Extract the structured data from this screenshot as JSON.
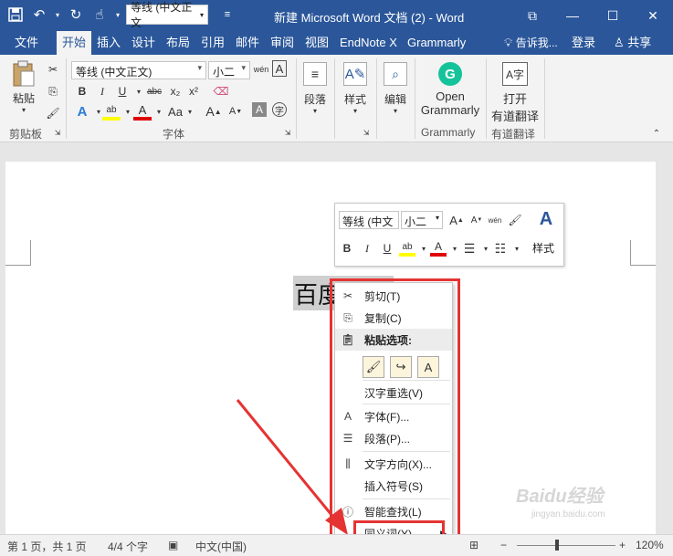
{
  "titlebar": {
    "title": "新建 Microsoft Word 文档 (2) - Word",
    "qat_font": "等线 (中文正文",
    "icons": [
      "save-icon",
      "undo-icon",
      "redo-icon",
      "touch-icon",
      "customize-icon"
    ]
  },
  "tabs": [
    {
      "label": "文件"
    },
    {
      "label": "开始",
      "active": true
    },
    {
      "label": "插入"
    },
    {
      "label": "设计"
    },
    {
      "label": "布局"
    },
    {
      "label": "引用"
    },
    {
      "label": "邮件"
    },
    {
      "label": "审阅"
    },
    {
      "label": "视图"
    },
    {
      "label": "EndNote X"
    },
    {
      "label": "Grammarly"
    }
  ],
  "tellme": "告诉我...",
  "signin": "登录",
  "share": "共享",
  "ribbon": {
    "paste": "粘贴",
    "clipboard_group": "剪贴板",
    "font_name": "等线 (中文正文)",
    "font_size": "小二",
    "font_group": "字体",
    "paragraph": "段落",
    "styles": "样式",
    "editing": "编辑",
    "grammarly_btn_line1": "Open",
    "grammarly_btn_line2": "Grammarly",
    "grammarly_group": "Grammarly",
    "translate_line1": "打开",
    "translate_line2": "有道翻译",
    "translate_group": "有道翻译",
    "bold": "B",
    "italic": "I",
    "underline": "U",
    "strike": "abc",
    "sub": "x₂",
    "sup": "x²",
    "wen": "wén",
    "a_big": "A",
    "a_small": "A"
  },
  "document": {
    "text": "百度经验"
  },
  "mini_toolbar": {
    "font": "等线 (中文",
    "size": "小二",
    "styles": "样式",
    "bold": "B",
    "italic": "I",
    "underline": "U"
  },
  "context_menu": {
    "cut": "剪切(T)",
    "copy": "复制(C)",
    "paste_options": "粘贴选项:",
    "reconvert": "汉字重选(V)",
    "font": "字体(F)...",
    "paragraph": "段落(P)...",
    "text_direction": "文字方向(X)...",
    "insert_symbol": "插入符号(S)",
    "smart_lookup": "智能查找(L)",
    "synonyms": "同义词(Y)"
  },
  "statusbar": {
    "page": "第 1 页，共 1 页",
    "words": "4/4 个字",
    "language": "中文(中国)",
    "zoom": "120%"
  },
  "watermark": {
    "brand": "Baidu经验",
    "url": "jingyan.baidu.com"
  },
  "colors": {
    "word_blue": "#2b579a",
    "annotation_red": "#e53333",
    "grammarly_green": "#15c39a"
  }
}
